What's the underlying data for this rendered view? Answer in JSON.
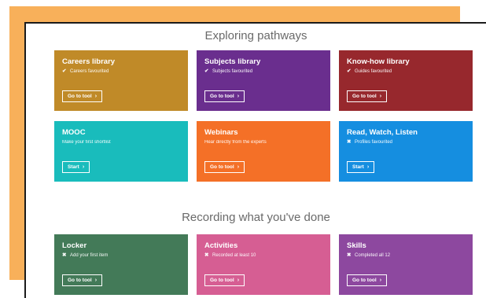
{
  "colors": {
    "backdrop": "#f8b05a",
    "careers": "#c08a28",
    "subjects": "#6a2e8e",
    "knowhow": "#97282d",
    "mooc": "#19bcbc",
    "webinars": "#f47027",
    "read": "#158ee0",
    "locker": "#437a58",
    "activities": "#d65e93",
    "skills": "#8d489f"
  },
  "sections": {
    "exploring_title": "Exploring pathways",
    "recording_title": "Recording what you've done"
  },
  "cards": {
    "careers": {
      "title": "Careers library",
      "status": "Careers favourited",
      "status_icon": "check",
      "button": "Go to tool"
    },
    "subjects": {
      "title": "Subjects library",
      "status": "Subjects favourited",
      "status_icon": "check",
      "button": "Go to tool"
    },
    "knowhow": {
      "title": "Know-how library",
      "status": "Guides favourited",
      "status_icon": "check",
      "button": "Go to tool"
    },
    "mooc": {
      "title": "MOOC",
      "status": "Make your first shortlist",
      "status_icon": "",
      "button": "Start"
    },
    "webinars": {
      "title": "Webinars",
      "status": "Hear directly from the experts",
      "status_icon": "",
      "button": "Go to tool"
    },
    "read": {
      "title": "Read, Watch, Listen",
      "status": "Profiles favourited",
      "status_icon": "cross",
      "button": "Start"
    },
    "locker": {
      "title": "Locker",
      "status": "Add your first item",
      "status_icon": "cross",
      "button": "Go to tool"
    },
    "activities": {
      "title": "Activities",
      "status": "Recorded at least 10",
      "status_icon": "cross",
      "button": "Go to tool"
    },
    "skills": {
      "title": "Skills",
      "status": "Completed all 12",
      "status_icon": "cross",
      "button": "Go to tool"
    }
  },
  "glyphs": {
    "check": "✔",
    "cross": "✖",
    "chevron": "›"
  }
}
